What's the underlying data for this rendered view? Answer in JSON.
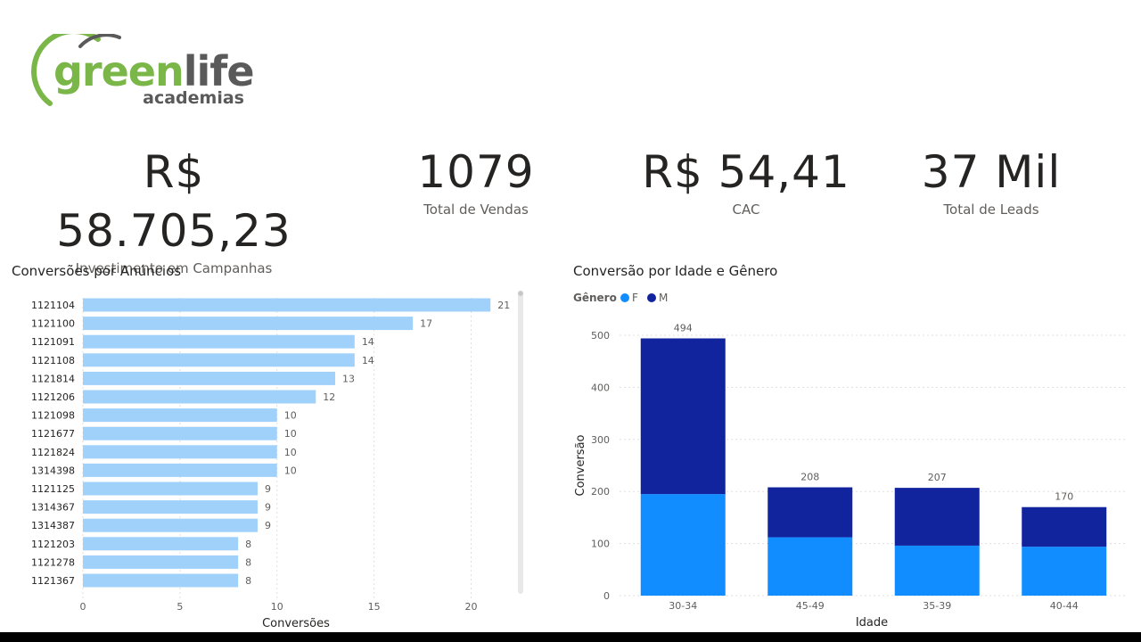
{
  "brand": {
    "name_part1": "green",
    "name_part2": "life",
    "sub": "academias"
  },
  "kpis": [
    {
      "value": "R$ 58.705,23",
      "label": "Investimento em Campanhas"
    },
    {
      "value": "1079",
      "label": "Total de Vendas"
    },
    {
      "value": "R$ 54,41",
      "label": "CAC"
    },
    {
      "value": "37 Mil",
      "label": "Total de Leads"
    }
  ],
  "colors": {
    "bar_light": "#a0d1fa",
    "female": "#118dff",
    "male": "#12239e",
    "grid": "#e1dfdd",
    "axis_text": "#605e5c",
    "logo_green": "#7ab648",
    "logo_gray": "#5a5a5a"
  },
  "chart_data": [
    {
      "type": "bar",
      "orientation": "horizontal",
      "title": "Conversões por Anúncios",
      "xlabel": "Conversões",
      "ylabel": "",
      "categories": [
        "1121104",
        "1121100",
        "1121091",
        "1121108",
        "1121814",
        "1121206",
        "1121098",
        "1121677",
        "1121824",
        "1314398",
        "1121125",
        "1314367",
        "1314387",
        "1121203",
        "1121278",
        "1121367"
      ],
      "values": [
        21,
        17,
        14,
        14,
        13,
        12,
        10,
        10,
        10,
        10,
        9,
        9,
        9,
        8,
        8,
        8
      ],
      "xlim": [
        0,
        22
      ],
      "xticks": [
        0,
        5,
        10,
        15,
        20
      ],
      "grid": true
    },
    {
      "type": "bar",
      "stacked": true,
      "title": "Conversão por Idade e Gênero",
      "xlabel": "Idade",
      "ylabel": "Conversão",
      "legend_title": "Gênero",
      "legend_position": "top-left",
      "categories": [
        "30-34",
        "45-49",
        "35-39",
        "40-44"
      ],
      "series": [
        {
          "name": "F",
          "values": [
            195,
            112,
            96,
            94
          ]
        },
        {
          "name": "M",
          "values": [
            299,
            96,
            111,
            76
          ]
        }
      ],
      "totals": [
        494,
        208,
        207,
        170
      ],
      "ylim": [
        0,
        500
      ],
      "yticks": [
        0,
        100,
        200,
        300,
        400,
        500
      ],
      "grid": true
    }
  ]
}
